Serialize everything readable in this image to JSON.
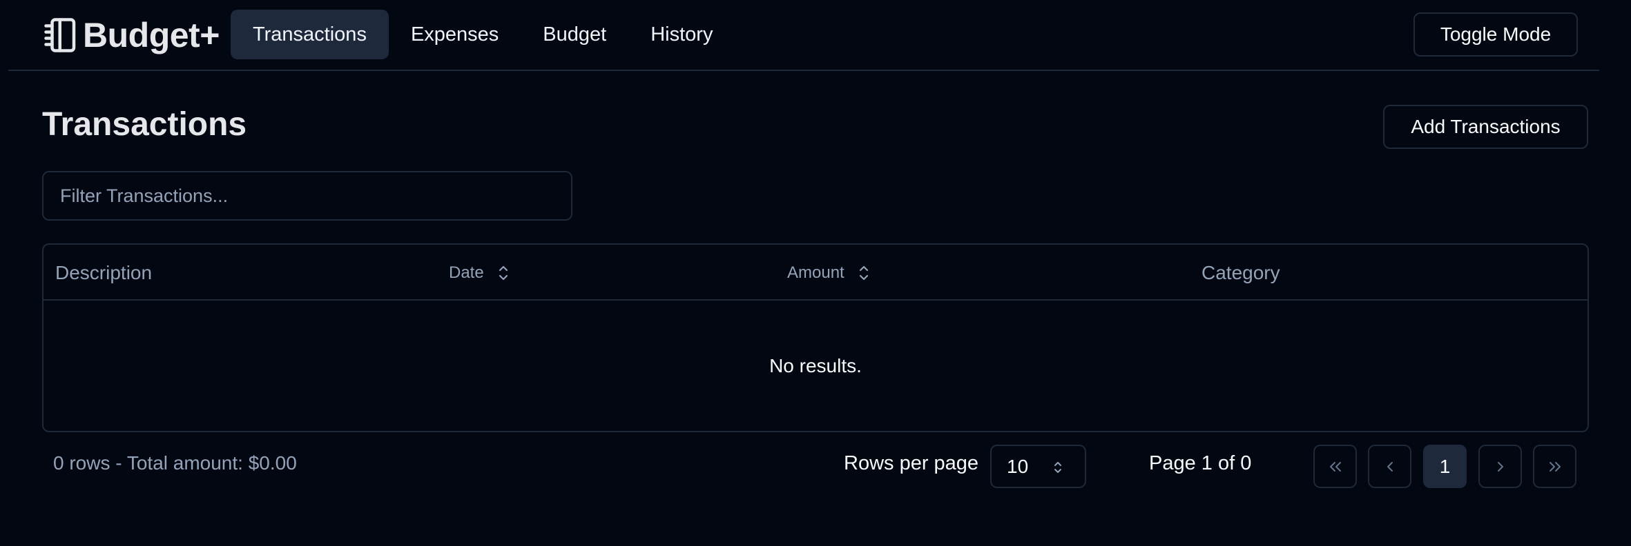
{
  "app": {
    "name": "Budget+",
    "logo_icon": "notebook-icon"
  },
  "nav": {
    "items": [
      {
        "label": "Transactions",
        "active": true
      },
      {
        "label": "Expenses",
        "active": false
      },
      {
        "label": "Budget",
        "active": false
      },
      {
        "label": "History",
        "active": false
      }
    ],
    "toggle_label": "Toggle Mode"
  },
  "main": {
    "title": "Transactions",
    "add_label": "Add Transactions",
    "filter": {
      "placeholder": "Filter Transactions...",
      "value": ""
    },
    "table": {
      "columns": [
        {
          "label": "Description",
          "sortable": false
        },
        {
          "label": "Date",
          "sortable": true
        },
        {
          "label": "Amount",
          "sortable": true
        },
        {
          "label": "Category",
          "sortable": false
        }
      ],
      "rows": [],
      "empty_text": "No results."
    }
  },
  "footer": {
    "summary": "0 rows - Total amount: $0.00",
    "rows_per_page_label": "Rows per page",
    "rows_per_page_value": "10",
    "page_info": "Page 1 of 0",
    "current_page": "1"
  },
  "colors": {
    "background": "#030712",
    "border": "#1f2937",
    "active_bg": "#1e293b",
    "muted_text": "#94a3b8",
    "text": "#f8fafc"
  }
}
